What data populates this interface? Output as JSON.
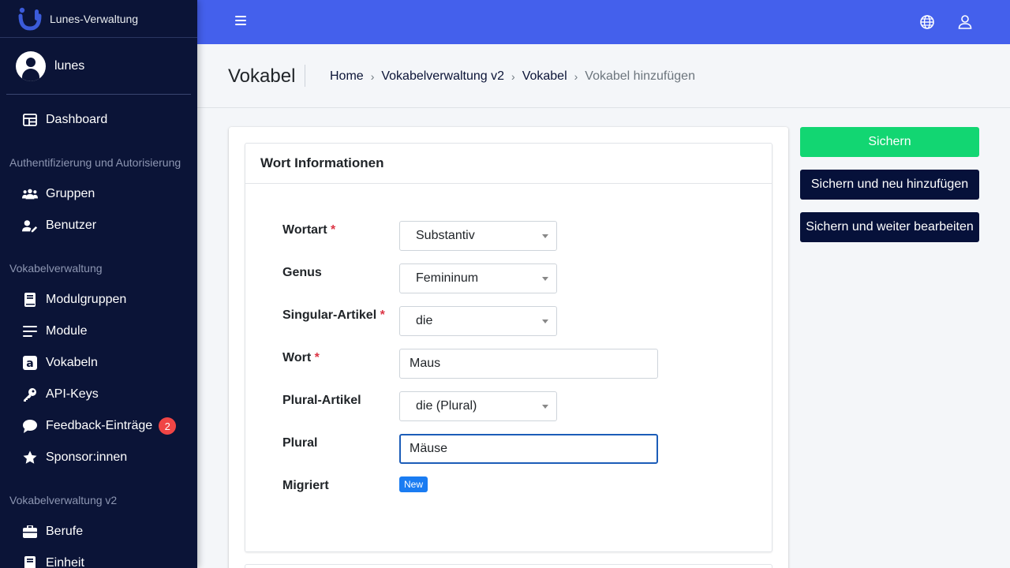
{
  "brand": {
    "name": "Lunes-Verwaltung"
  },
  "user": {
    "name": "lunes"
  },
  "sidebar": {
    "dashboard": "Dashboard",
    "section_auth": "Authentifizierung und Autorisierung",
    "gruppen": "Gruppen",
    "benutzer": "Benutzer",
    "section_vokabel": "Vokabelverwaltung",
    "modulgruppen": "Modulgruppen",
    "module": "Module",
    "vokabeln": "Vokabeln",
    "api_keys": "API-Keys",
    "feedback": "Feedback-Einträge",
    "feedback_count": "2",
    "sponsoren": "Sponsor:innen",
    "section_vokabel_v2": "Vokabelverwaltung v2",
    "berufe": "Berufe",
    "einheit": "Einheit"
  },
  "header": {
    "title": "Vokabel",
    "breadcrumb": {
      "home": "Home",
      "v2": "Vokabelverwaltung v2",
      "vokabel": "Vokabel",
      "current": "Vokabel hinzufügen"
    }
  },
  "form": {
    "card_title": "Wort Informationen",
    "wortart": {
      "label": "Wortart",
      "required": "*",
      "value": "Substantiv"
    },
    "genus": {
      "label": "Genus",
      "value": "Femininum"
    },
    "singular_artikel": {
      "label": "Singular-Artikel",
      "required": "*",
      "value": "die"
    },
    "wort": {
      "label": "Wort",
      "required": "*",
      "value": "Maus"
    },
    "plural_artikel": {
      "label": "Plural-Artikel",
      "value": "die (Plural)"
    },
    "plural": {
      "label": "Plural",
      "value": "Mäuse"
    },
    "migriert": {
      "label": "Migriert",
      "badge": "New"
    }
  },
  "actions": {
    "save": "Sichern",
    "save_add": "Sichern und neu hinzufügen",
    "save_continue": "Sichern und weiter bearbeiten"
  },
  "colors": {
    "sidebar_bg": "#0b1437",
    "topbar_bg": "#4460ec",
    "save_green": "#12d672",
    "dark_button": "#06113a",
    "badge_red": "#f04545",
    "new_badge_blue": "#1a7cf2"
  },
  "icons": {
    "brand": "lunes-logo-icon",
    "menu": "hamburger-icon",
    "language": "globe-icon",
    "account": "user-icon"
  }
}
